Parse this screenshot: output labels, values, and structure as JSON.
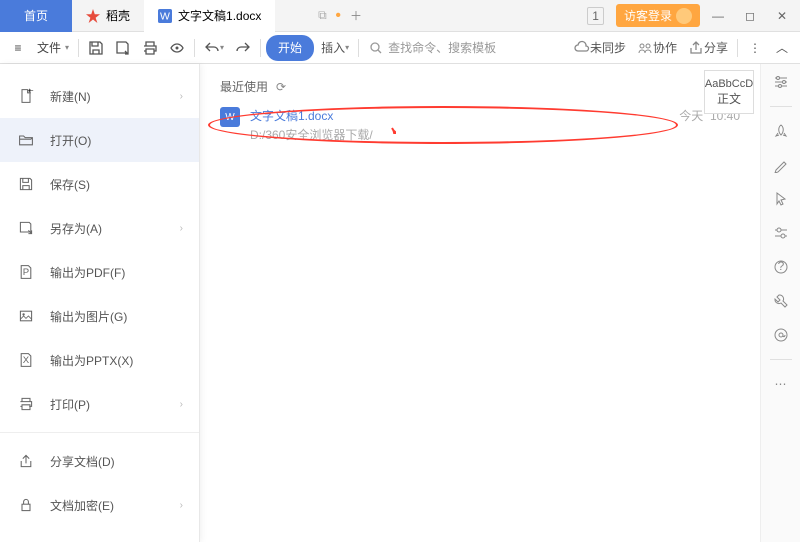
{
  "tabs": {
    "home": "首页",
    "daoke": "稻壳",
    "doc": "文字文稿1.docx"
  },
  "login_label": "访客登录",
  "window_counter": "1",
  "toolbar": {
    "file_label": "文件",
    "start_label": "开始",
    "insert_label": "插入",
    "search_placeholder": "查找命令、搜索模板",
    "unsync_label": "未同步",
    "collab_label": "协作",
    "share_label": "分享"
  },
  "menu": {
    "new": "新建(N)",
    "open": "打开(O)",
    "save": "保存(S)",
    "saveas": "另存为(A)",
    "pdf": "输出为PDF(F)",
    "img": "输出为图片(G)",
    "pptx": "输出为PPTX(X)",
    "print": "打印(P)",
    "sharedoc": "分享文档(D)",
    "encrypt": "文档加密(E)"
  },
  "recent": {
    "header": "最近使用",
    "file_name": "文字文稿1.docx",
    "file_path": "D:/360安全浏览器下载/",
    "file_time_day": "今天",
    "file_time_clock": "10:40"
  },
  "style_preview": {
    "sample": "AaBbCcD",
    "name": "正文"
  }
}
